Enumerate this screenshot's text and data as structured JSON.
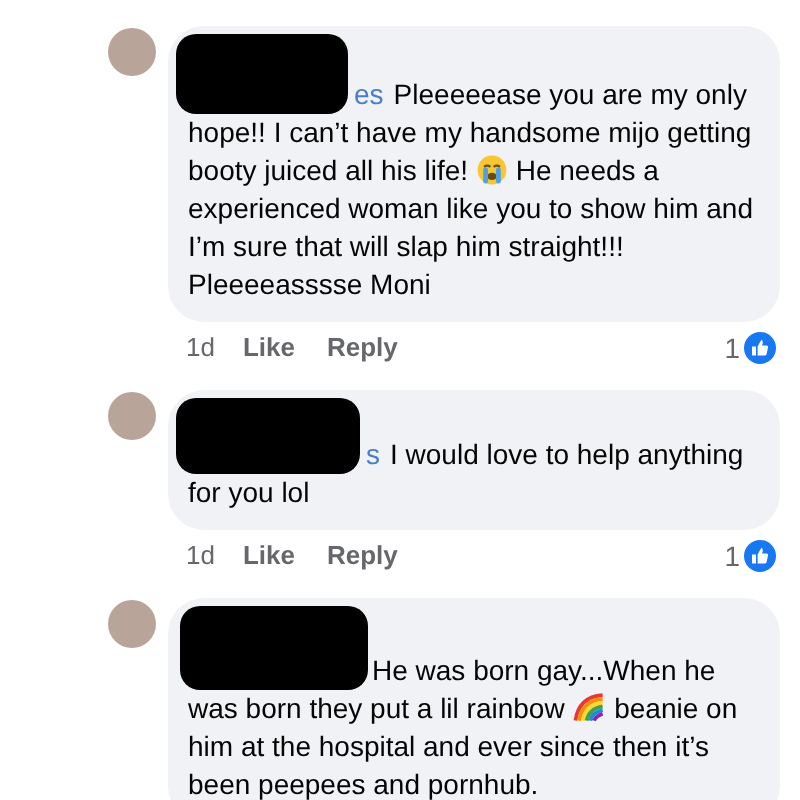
{
  "comments": [
    {
      "name_fragment": "es",
      "first_line": "Pleeeeease you are my only",
      "segments": [
        {
          "kind": "text",
          "text": "hope!! I can’t have my handsome mijo getting booty juiced all his life! "
        },
        {
          "kind": "crying"
        },
        {
          "kind": "text",
          "text": " He needs a experienced woman like you to show him and I’m sure that will slap him straight!!! Pleeeeasssse Moni"
        }
      ],
      "time": "1d",
      "actions": [
        "Like",
        "Reply"
      ],
      "reaction_count": "1"
    },
    {
      "name_fragment": "s",
      "first_line": "I would love to help anything",
      "segments": [
        {
          "kind": "text",
          "text": "for you lol"
        }
      ],
      "time": "1d",
      "actions": [
        "Like",
        "Reply"
      ],
      "reaction_count": "1"
    },
    {
      "first_line": "He was born gay...When he",
      "segments": [
        {
          "kind": "text",
          "text": "was born they put a lil rainbow "
        },
        {
          "kind": "rainbow"
        },
        {
          "kind": "text",
          "text": " beanie on him at the hospital and ever since then it’s been peepees and pornhub."
        }
      ]
    }
  ]
}
